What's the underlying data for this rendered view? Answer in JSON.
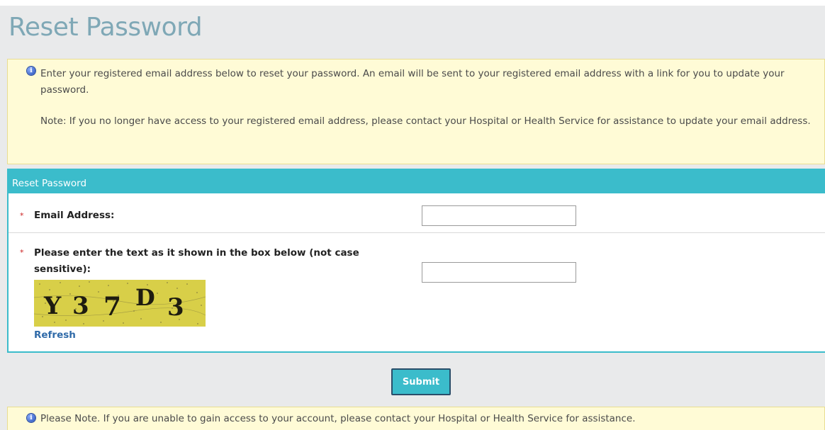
{
  "page_title": "Reset Password",
  "info_top": {
    "icon": "info-icon",
    "paragraph1": "Enter your registered email address below to reset your password. An email will be sent to your registered email address with a link for you to update your password.",
    "paragraph2": "Note: If you no longer have access to your registered email address, please contact your Hospital or Health Service for assistance to update your email address."
  },
  "form": {
    "header": "Reset Password",
    "required_symbol": "*",
    "email_label": "Email Address:",
    "email_value": "",
    "captcha_label": "Please enter the text as it shown in the box below (not case sensitive):",
    "captcha_value": "",
    "captcha_text": "Y37D3",
    "refresh_label": "Refresh"
  },
  "submit_label": "Submit",
  "info_bottom": {
    "icon": "info-icon",
    "text": "Please Note. If you are unable to gain access to your account, please contact your Hospital or Health Service for assistance."
  },
  "colors": {
    "title": "#7fa8b6",
    "accent": "#3bbccb",
    "info_bg": "#fffbd6",
    "info_border": "#e8dd92",
    "required": "#cc2222",
    "link": "#2f6aa8",
    "captcha_bg": "#d8cf48"
  }
}
